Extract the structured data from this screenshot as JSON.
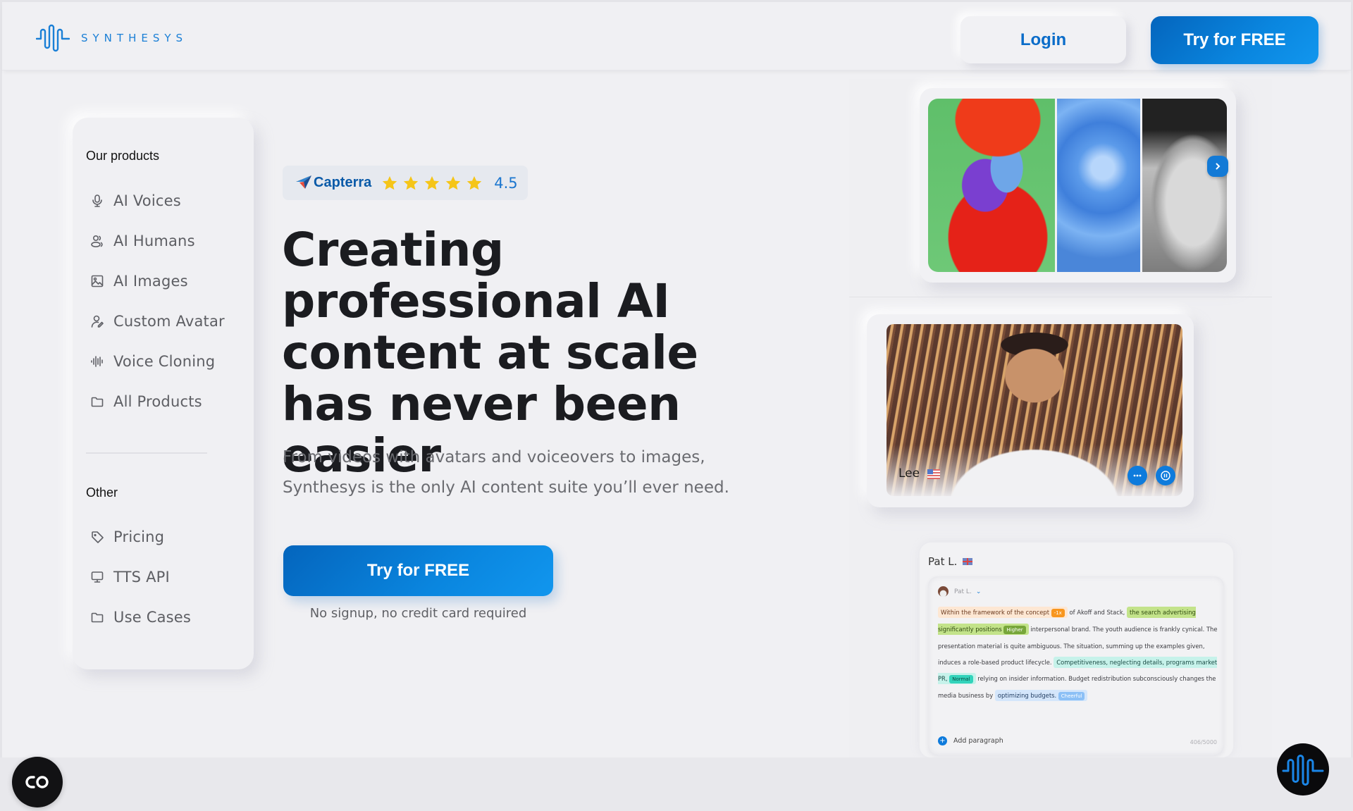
{
  "header": {
    "logo_text": "SYNTHESYS",
    "login_label": "Login",
    "try_label": "Try for FREE"
  },
  "sidebar": {
    "products_heading": "Our products",
    "products": [
      {
        "label": "AI Voices",
        "icon": "microphone-icon"
      },
      {
        "label": "AI Humans",
        "icon": "users-icon"
      },
      {
        "label": "AI Images",
        "icon": "image-icon"
      },
      {
        "label": "Custom Avatar",
        "icon": "user-edit-icon"
      },
      {
        "label": "Voice Cloning",
        "icon": "waveform-icon"
      },
      {
        "label": "All Products",
        "icon": "folder-icon"
      }
    ],
    "other_heading": "Other",
    "other": [
      {
        "label": "Pricing",
        "icon": "tag-icon"
      },
      {
        "label": "TTS API",
        "icon": "monitor-icon"
      },
      {
        "label": "Use Cases",
        "icon": "folder-icon"
      }
    ]
  },
  "hero": {
    "capterra": {
      "brand": "Capterra",
      "stars": 5,
      "rating": "4.5"
    },
    "headline": "Creating professional AI content at scale has never been easier",
    "subtitle": "From videos with avatars and voiceovers to images, Synthesys is the only AI content suite you’ll ever need.",
    "cta_label": "Try for FREE",
    "cta_note": "No signup, no credit card required"
  },
  "showcase": {
    "images": [
      "parrot",
      "blue rose",
      "elderly woman portrait"
    ],
    "video": {
      "avatar_name": "Lee",
      "flag": "us-flag"
    },
    "editor": {
      "title": "Pat L.",
      "voice_name": "Pat L.",
      "segments": [
        {
          "text": "Within the framework of the concept",
          "style": "orange",
          "tag": "-1x"
        },
        {
          "text": " of Akoff and Stack, ",
          "style": "plain"
        },
        {
          "text": "the search advertising significantly positions",
          "style": "green",
          "tag": "Higher"
        },
        {
          "text": " interpersonal brand. The youth audience is frankly cynical. The presentation material is quite ambiguous. The situation, summing up the examples given, induces a role-based product lifecycle. ",
          "style": "plain"
        },
        {
          "text": "Competitiveness, neglecting details, programs market PR,",
          "style": "teal",
          "tag": "Normal"
        },
        {
          "text": " relying on insider information. Budget redistribution subconsciously changes the media business by ",
          "style": "plain"
        },
        {
          "text": "optimizing budgets.",
          "style": "blue",
          "tag": "Cheerful"
        }
      ],
      "add_paragraph": "Add paragraph",
      "char_count": "406/5000"
    }
  },
  "colors": {
    "brand_blue": "#0a7fd8",
    "background": "#f0f0f3",
    "star": "#f5c518"
  }
}
